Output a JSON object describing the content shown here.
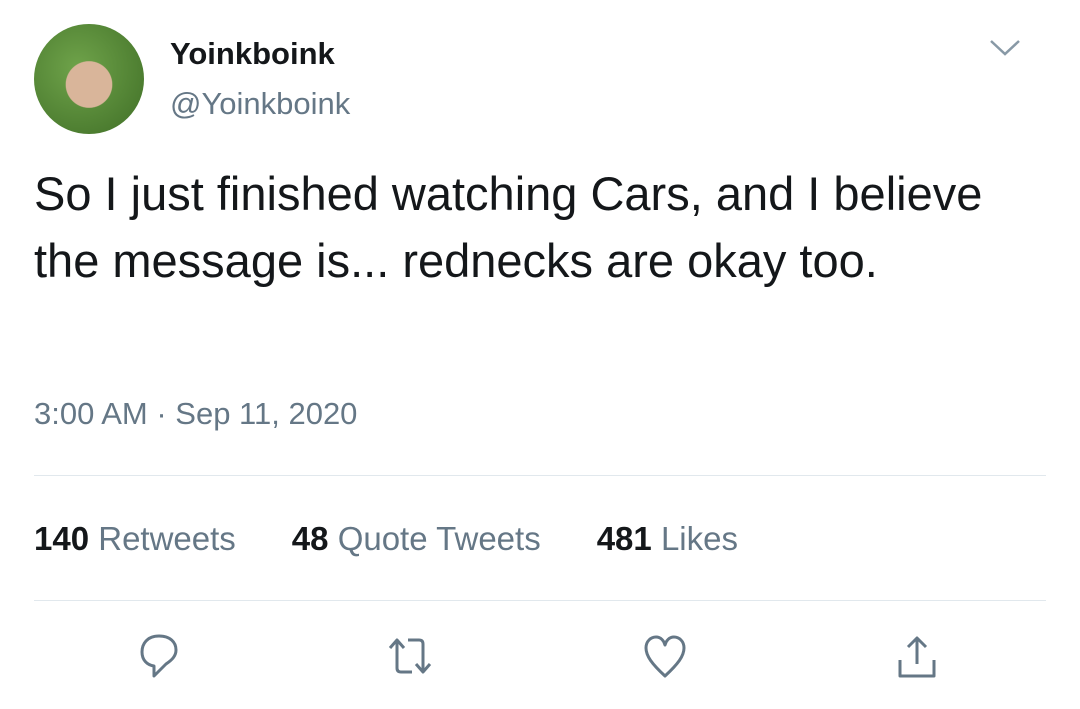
{
  "user": {
    "name": "Yoinkboink",
    "handle": "@Yoinkboink"
  },
  "tweet": {
    "text": "So I just finished watching Cars, and I believe the message is... rednecks are okay too.",
    "timestamp": "3:00 AM · Sep 11, 2020"
  },
  "stats": [
    {
      "count": "140",
      "label": "Retweets"
    },
    {
      "count": "48",
      "label": "Quote Tweets"
    },
    {
      "count": "481",
      "label": "Likes"
    }
  ],
  "icons": [
    "reply-icon",
    "retweet-icon",
    "like-icon",
    "share-icon"
  ],
  "colors": {
    "icon": "#657786",
    "divider": "#e1e8ed"
  }
}
